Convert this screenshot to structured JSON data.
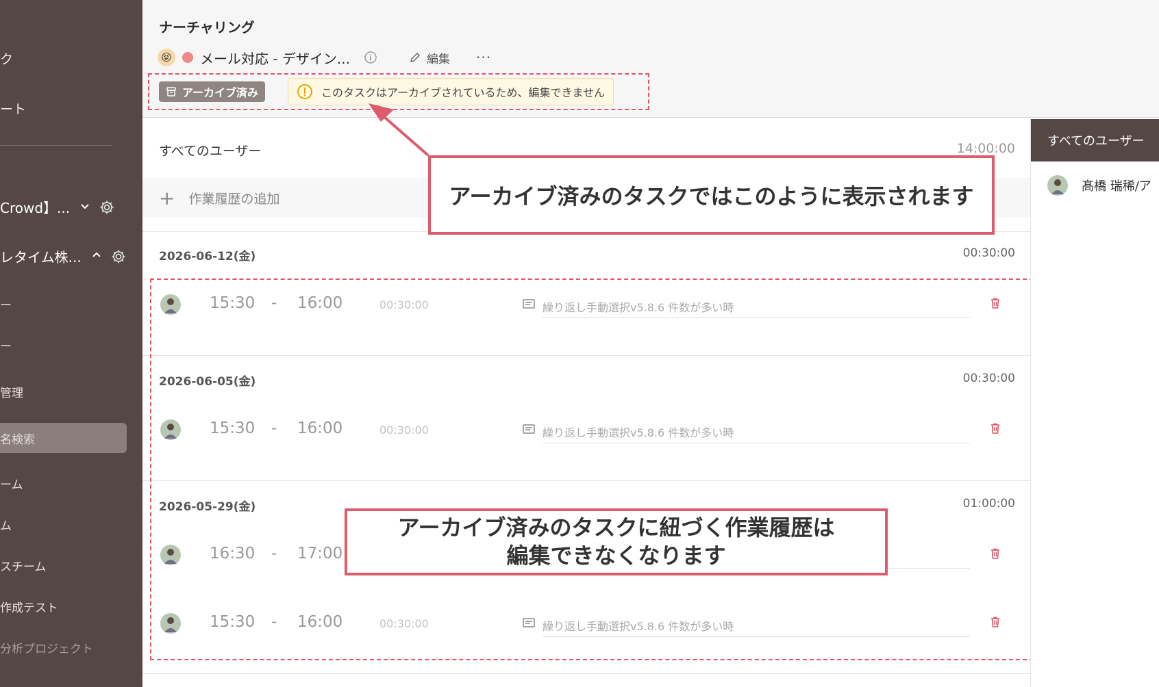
{
  "sidebar": {
    "top_items": [
      "ク",
      "ート"
    ],
    "groups": [
      {
        "label": "Crowd】...",
        "expanded": false
      },
      {
        "label": "レタイム株...",
        "expanded": true
      }
    ],
    "sub_items": [
      "ー",
      "ー",
      "管理",
      "名検索",
      "ーム",
      "ム",
      "スチーム",
      "作成テスト",
      "分析プロジェクト"
    ],
    "selected_index": 3
  },
  "header": {
    "page_title": "ナーチャリング",
    "task_emoji": "😝",
    "task_name": "メール対応 - デザイン...",
    "edit_label": "編集",
    "more_label": "···",
    "archived_badge": "アーカイブ済み",
    "archive_message": "このタスクはアーカイブされているため、編集できません"
  },
  "main": {
    "users_label": "すべてのユーザー",
    "total_time": "14:00:00",
    "add_history_label": "作業履歴の追加",
    "days": [
      {
        "date": "2026-06-12(金)",
        "total": "00:30:00",
        "entries": [
          {
            "start": "15:30",
            "dash": "-",
            "end": "16:00",
            "duration": "00:30:00",
            "note": "繰り返し手動選択v5.8.6 件数が多い時"
          }
        ]
      },
      {
        "date": "2026-06-05(金)",
        "total": "00:30:00",
        "entries": [
          {
            "start": "15:30",
            "dash": "-",
            "end": "16:00",
            "duration": "00:30:00",
            "note": "繰り返し手動選択v5.8.6 件数が多い時"
          }
        ]
      },
      {
        "date": "2026-05-29(金)",
        "total": "01:00:00",
        "entries": [
          {
            "start": "16:30",
            "dash": "-",
            "end": "17:00",
            "duration": "",
            "note": ""
          },
          {
            "start": "15:30",
            "dash": "-",
            "end": "16:00",
            "duration": "00:30:00",
            "note": "繰り返し手動選択v5.8.6 件数が多い時"
          }
        ]
      }
    ]
  },
  "right_panel": {
    "header": "すべてのユーザー",
    "user_name": "髙橋 瑞稀/ア"
  },
  "callouts": {
    "top": "アーカイブ済みのタスクではこのように表示されます",
    "bottom_line1": "アーカイブ済みのタスクに紐づく作業履歴は",
    "bottom_line2": "編集できなくなります"
  },
  "colors": {
    "sidebar_bg": "#544744",
    "accent_red": "#dd5c6c",
    "badge_bg": "#8f8583",
    "warning_bg": "#fff8e5"
  }
}
